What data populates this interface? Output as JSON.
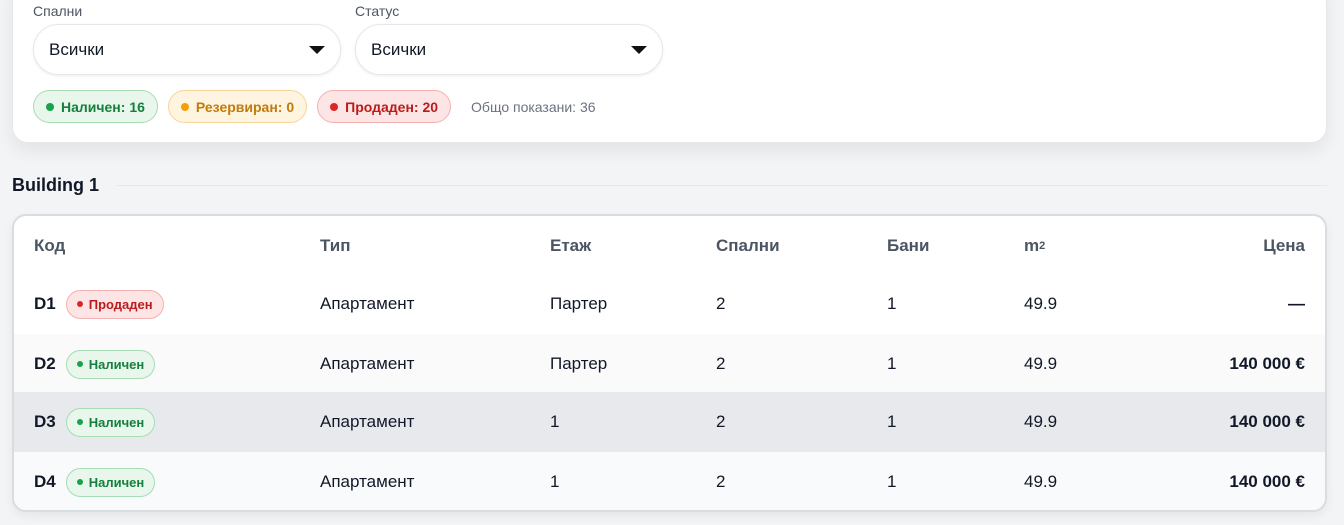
{
  "filters": {
    "bedrooms": {
      "label": "Спални",
      "value": "Всички"
    },
    "status": {
      "label": "Статус",
      "value": "Всички"
    }
  },
  "counts": {
    "available": "Наличен: 16",
    "reserved": "Резервиран: 0",
    "sold": "Продаден: 20",
    "total": "Общо показани: 36"
  },
  "section": {
    "title": "Building 1"
  },
  "table": {
    "headers": {
      "code": "Код",
      "type": "Тип",
      "floor": "Етаж",
      "bedrooms": "Спални",
      "bathrooms": "Бани",
      "area": "m",
      "area_sup": "2",
      "price": "Цена"
    },
    "rows": [
      {
        "code": "D1",
        "status": "Продаден",
        "type": "Апартамент",
        "floor": "Партер",
        "bedrooms": "2",
        "bathrooms": "1",
        "area": "49.9",
        "price": "—"
      },
      {
        "code": "D2",
        "status": "Наличен",
        "type": "Апартамент",
        "floor": "Партер",
        "bedrooms": "2",
        "bathrooms": "1",
        "area": "49.9",
        "price": "140 000 €"
      },
      {
        "code": "D3",
        "status": "Наличен",
        "type": "Апартамент",
        "floor": "1",
        "bedrooms": "2",
        "bathrooms": "1",
        "area": "49.9",
        "price": "140 000 €"
      },
      {
        "code": "D4",
        "status": "Наличен",
        "type": "Апартамент",
        "floor": "1",
        "bedrooms": "2",
        "bathrooms": "1",
        "area": "49.9",
        "price": "140 000 €"
      }
    ]
  },
  "colors": {
    "available": "#16a34a",
    "reserved": "#f59e0b",
    "sold": "#dc2626"
  }
}
